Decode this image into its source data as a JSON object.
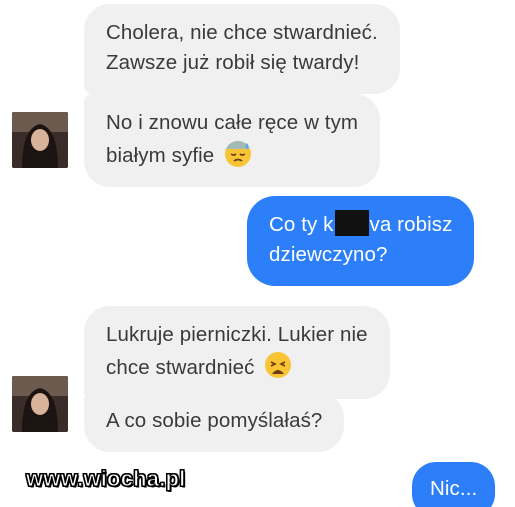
{
  "messages": {
    "m1": {
      "line1": "Cholera, nie chce stwardnieć.",
      "line2": "Zawsze już robił się twardy!"
    },
    "m2": {
      "line1": "No i znowu całe ręce w tym",
      "line2": "białym syfie",
      "emoji": "sweat-face-emoji"
    },
    "m3": {
      "line1_before": "Co ty k",
      "line1_after": "va robisz",
      "line2": "dziewczyno?"
    },
    "m4": {
      "line1": "Lukruje pierniczki. Lukier nie",
      "line2": "chce stwardnieć",
      "emoji": "weary-face-emoji"
    },
    "m5": {
      "line1": "A co sobie pomyślałaś?"
    },
    "m6": {
      "line1": "Nic..."
    }
  },
  "watermark": "www.wiocha.pl",
  "colors": {
    "incoming_bg": "#f1f0f0",
    "outgoing_bg": "#2d7ff9",
    "incoming_text": "#3a3a3a",
    "outgoing_text": "#ffffff"
  }
}
